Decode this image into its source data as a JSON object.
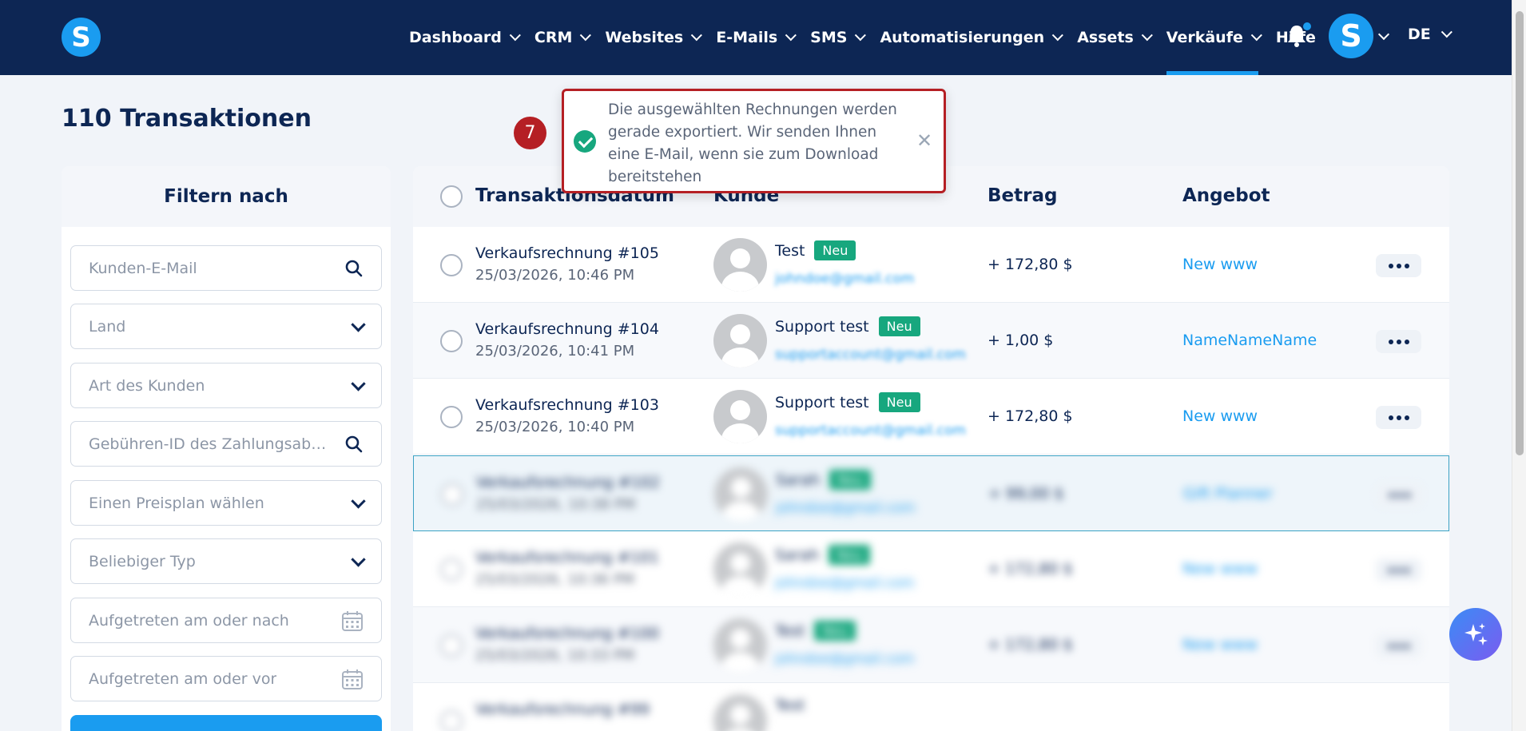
{
  "nav": {
    "items": [
      {
        "label": "Dashboard",
        "has_menu": true
      },
      {
        "label": "CRM",
        "has_menu": true
      },
      {
        "label": "Websites",
        "has_menu": true
      },
      {
        "label": "E-Mails",
        "has_menu": true
      },
      {
        "label": "SMS",
        "has_menu": true
      },
      {
        "label": "Automatisierungen",
        "has_menu": true
      },
      {
        "label": "Assets",
        "has_menu": true
      },
      {
        "label": "Verkäufe",
        "has_menu": true,
        "active": true
      },
      {
        "label": "Hilfe",
        "has_menu": false
      }
    ],
    "logo_letter": "S",
    "avatar_letter": "S",
    "language": "DE",
    "notification_icon": "bell-icon"
  },
  "page": {
    "title": "110 Transaktionen"
  },
  "filters": {
    "heading": "Filtern nach",
    "fields": [
      {
        "placeholder": "Kunden-E-Mail",
        "icon": "search-icon"
      },
      {
        "placeholder": "Land",
        "icon": "chevron-down-icon"
      },
      {
        "placeholder": "Art des Kunden",
        "icon": "chevron-down-icon"
      },
      {
        "placeholder": "Gebühren-ID des Zahlungsabwic...",
        "icon": "search-icon"
      },
      {
        "placeholder": "Einen Preisplan wählen",
        "icon": "chevron-down-icon"
      },
      {
        "placeholder": "Beliebiger Typ",
        "icon": "chevron-down-icon"
      },
      {
        "placeholder": "Aufgetreten am oder nach",
        "icon": "calendar-icon"
      },
      {
        "placeholder": "Aufgetreten am oder vor",
        "icon": "calendar-icon"
      }
    ]
  },
  "table": {
    "columns": [
      "Transaktionsdatum",
      "Kunde",
      "Betrag",
      "Angebot"
    ],
    "rows": [
      {
        "invoice": "Verkaufsrechnung #105",
        "date": "25/03/2026, 10:46 PM",
        "customer": "Test",
        "badge": "Neu",
        "email": "johndoe@gmail.com",
        "amount": "+ 172,80 $",
        "offer": "New www"
      },
      {
        "invoice": "Verkaufsrechnung #104",
        "date": "25/03/2026, 10:41 PM",
        "customer": "Support test",
        "badge": "Neu",
        "email": "supportaccount@gmail.com",
        "amount": "+ 1,00 $",
        "offer": "NameNameName"
      },
      {
        "invoice": "Verkaufsrechnung #103",
        "date": "25/03/2026, 10:40 PM",
        "customer": "Support test",
        "badge": "Neu",
        "email": "supportaccount@gmail.com",
        "amount": "+ 172,80 $",
        "offer": "New www"
      },
      {
        "invoice": "Verkaufsrechnung #102",
        "date": "25/03/2026, 10:38 PM",
        "customer": "Sarah",
        "badge": "Neu",
        "email": "johndoe@gmail.com",
        "amount": "+ 99,00 $",
        "offer": "Gift Planner"
      },
      {
        "invoice": "Verkaufsrechnung #101",
        "date": "25/03/2026, 10:36 PM",
        "customer": "Sarah",
        "badge": "Neu",
        "email": "johndoe@gmail.com",
        "amount": "+ 172,80 $",
        "offer": "New www"
      },
      {
        "invoice": "Verkaufsrechnung #100",
        "date": "25/03/2026, 10:33 PM",
        "customer": "Test",
        "badge": "Neu",
        "email": "johndoe@gmail.com",
        "amount": "+ 172,80 $",
        "offer": "New www"
      },
      {
        "invoice": "Verkaufsrechnung #99",
        "date": "",
        "customer": "Test",
        "badge": "",
        "email": "",
        "amount": "",
        "offer": ""
      }
    ]
  },
  "toast": {
    "message": "Die ausgewählten Rechnungen werden gerade exportiert. Wir senden Ihnen eine E-Mail, wenn sie zum Download bereitstehen",
    "step_number": "7"
  },
  "colors": {
    "nav_bg": "#0d2654",
    "accent": "#1a9cf0",
    "badge_green": "#17a77e",
    "highlight_red": "#b51f24"
  }
}
